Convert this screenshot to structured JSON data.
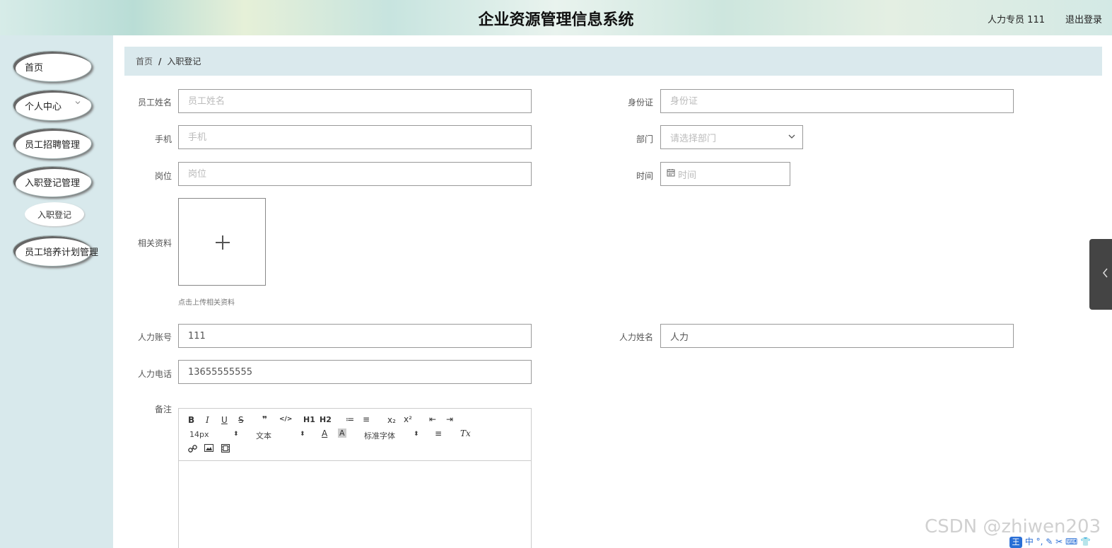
{
  "header": {
    "title": "企业资源管理信息系统",
    "user": "人力专员 111",
    "logout": "退出登录"
  },
  "sidebar": {
    "items": [
      {
        "label": "首页"
      },
      {
        "label": "个人中心"
      },
      {
        "label": "员工招聘管理"
      },
      {
        "label": "入职登记管理"
      },
      {
        "label": "员工培养计划管理"
      }
    ],
    "sub_item": "入职登记",
    "chevron": "chevron-down-icon"
  },
  "breadcrumb": {
    "home": "首页",
    "separator": "/",
    "current": "入职登记"
  },
  "form": {
    "employee_name": {
      "label": "员工姓名",
      "placeholder": "员工姓名",
      "value": ""
    },
    "id_card": {
      "label": "身份证",
      "placeholder": "身份证",
      "value": ""
    },
    "phone": {
      "label": "手机",
      "placeholder": "手机",
      "value": ""
    },
    "department": {
      "label": "部门",
      "placeholder": "请选择部门"
    },
    "position": {
      "label": "岗位",
      "placeholder": "岗位",
      "value": ""
    },
    "time": {
      "label": "时间",
      "placeholder": "时间"
    },
    "attachment": {
      "label": "相关资料",
      "hint": "点击上传相关资料"
    },
    "hr_account": {
      "label": "人力账号",
      "value": "111"
    },
    "hr_name": {
      "label": "人力姓名",
      "value": "人力"
    },
    "hr_phone": {
      "label": "人力电话",
      "value": "13655555555"
    },
    "remark": {
      "label": "备注"
    }
  },
  "editor": {
    "font_size": "14px",
    "header_select": "文本",
    "font_family": "标准字体",
    "buttons": {
      "bold": "B",
      "italic": "I",
      "underline": "U",
      "strike": "S",
      "quote": "❞",
      "code": "</>",
      "h1": "H1",
      "h2": "H2",
      "ordered": "≔",
      "bullet": "≡",
      "sub": "x₂",
      "sup": "x²",
      "outdent": "⇤",
      "indent": "⇥",
      "color": "A",
      "background": "A",
      "align": "≡",
      "clean": "Tx"
    }
  },
  "watermark": "CSDN @zhiwen203",
  "ime": {
    "badge": "王",
    "text": "中 °, ✎ ✂ ⌨ 👕"
  },
  "colors": {
    "sidebar_bg": "#d8e9ec",
    "breadcrumb_bg": "#dae9ed"
  }
}
